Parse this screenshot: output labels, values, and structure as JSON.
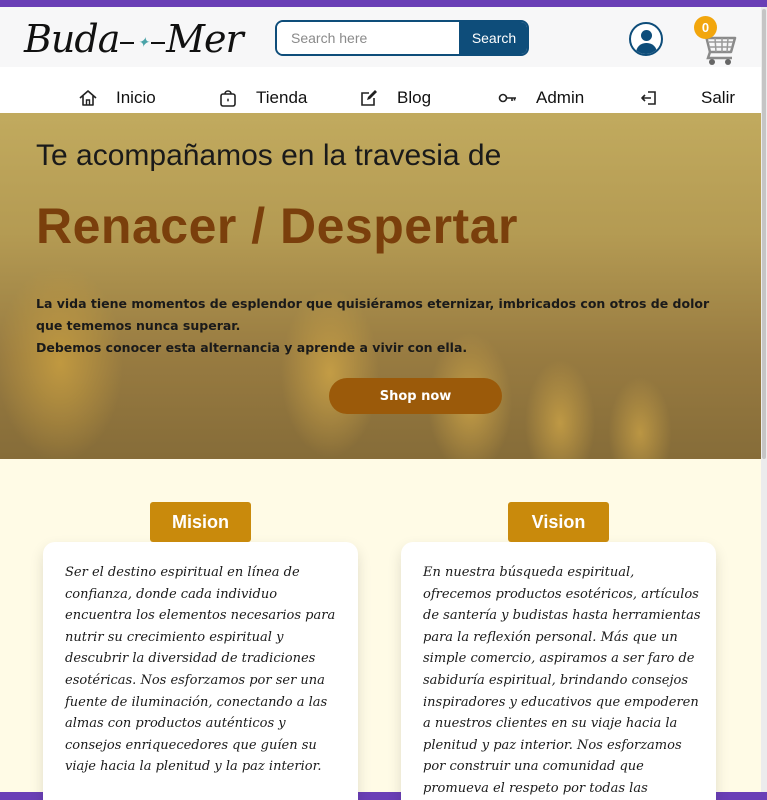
{
  "header": {
    "logo_left": "Buda",
    "logo_right": "Mer",
    "search_placeholder": "Search here",
    "search_button": "Search",
    "cart_count": "0"
  },
  "nav": {
    "items": [
      {
        "label": "Inicio",
        "icon": "home-icon"
      },
      {
        "label": "Tienda",
        "icon": "bag-icon"
      },
      {
        "label": "Blog",
        "icon": "edit-icon"
      },
      {
        "label": "Admin",
        "icon": "key-icon"
      },
      {
        "label": "Salir",
        "icon": "logout-icon"
      }
    ]
  },
  "hero": {
    "title": "Te acompañamos en la travesia de",
    "highlight": "Renacer / Despertar",
    "paragraph_1": "La vida tiene momentos de esplendor que quisiéramos eternizar, imbricados con otros de dolor que tememos nunca superar.",
    "paragraph_2": "Debemos conocer esta alternancia y aprende a vivir con ella.",
    "cta": "Shop now"
  },
  "mission": {
    "label": "Mision",
    "text": "Ser el destino espiritual en línea de confianza, donde cada individuo encuentra los elementos necesarios para nutrir su crecimiento espiritual y descubrir la diversidad de tradiciones esotéricas. Nos esforzamos por ser una fuente de iluminación, conectando a las almas con productos auténticos y consejos enriquecedores que guíen su viaje hacia la plenitud y la paz interior."
  },
  "vision": {
    "label": "Vision",
    "text": "En nuestra búsqueda espiritual, ofrecemos productos esotéricos, artículos de santería y budistas hasta herramientas para la reflexión personal. Más que un simple comercio, aspiramos a ser faro de sabiduría espiritual, brindando consejos inspiradores y educativos que empoderen a nuestros clientes en su viaje hacia la plenitud y paz interior. Nos esforzamos por construir una comunidad que promueva el respeto por todas las creencias y culturas"
  },
  "colors": {
    "brand_blue": "#0e4d7a",
    "accent_gold": "#c98a0c",
    "cta_brown": "#9b5a0a",
    "heading_brown": "#7a3f0c",
    "badge_orange": "#f2a60d"
  }
}
